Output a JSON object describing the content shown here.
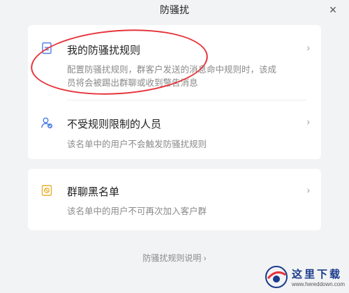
{
  "window": {
    "title": "防骚扰",
    "close_label": "×"
  },
  "rules": [
    {
      "title": "我的防骚扰规则",
      "desc": "配置防骚扰规则，群客户发送的消息命中规则时，该成员将会被踢出群聊或收到警告消息"
    },
    {
      "title": "不受规则限制的人员",
      "desc": "该名单中的用户不会触发防骚扰规则"
    }
  ],
  "blacklist": {
    "title": "群聊黑名单",
    "desc": "该名单中的用户不可再次加入客户群"
  },
  "chevron": "›",
  "footer": {
    "link_text": "防骚扰规则说明 ›"
  },
  "watermark": {
    "cn": "这里下载",
    "url": "www.hereddown.com"
  },
  "colors": {
    "accent_blue": "#4a7de8",
    "warning_yellow": "#e9b12c",
    "annotation_red": "#e5343a"
  }
}
